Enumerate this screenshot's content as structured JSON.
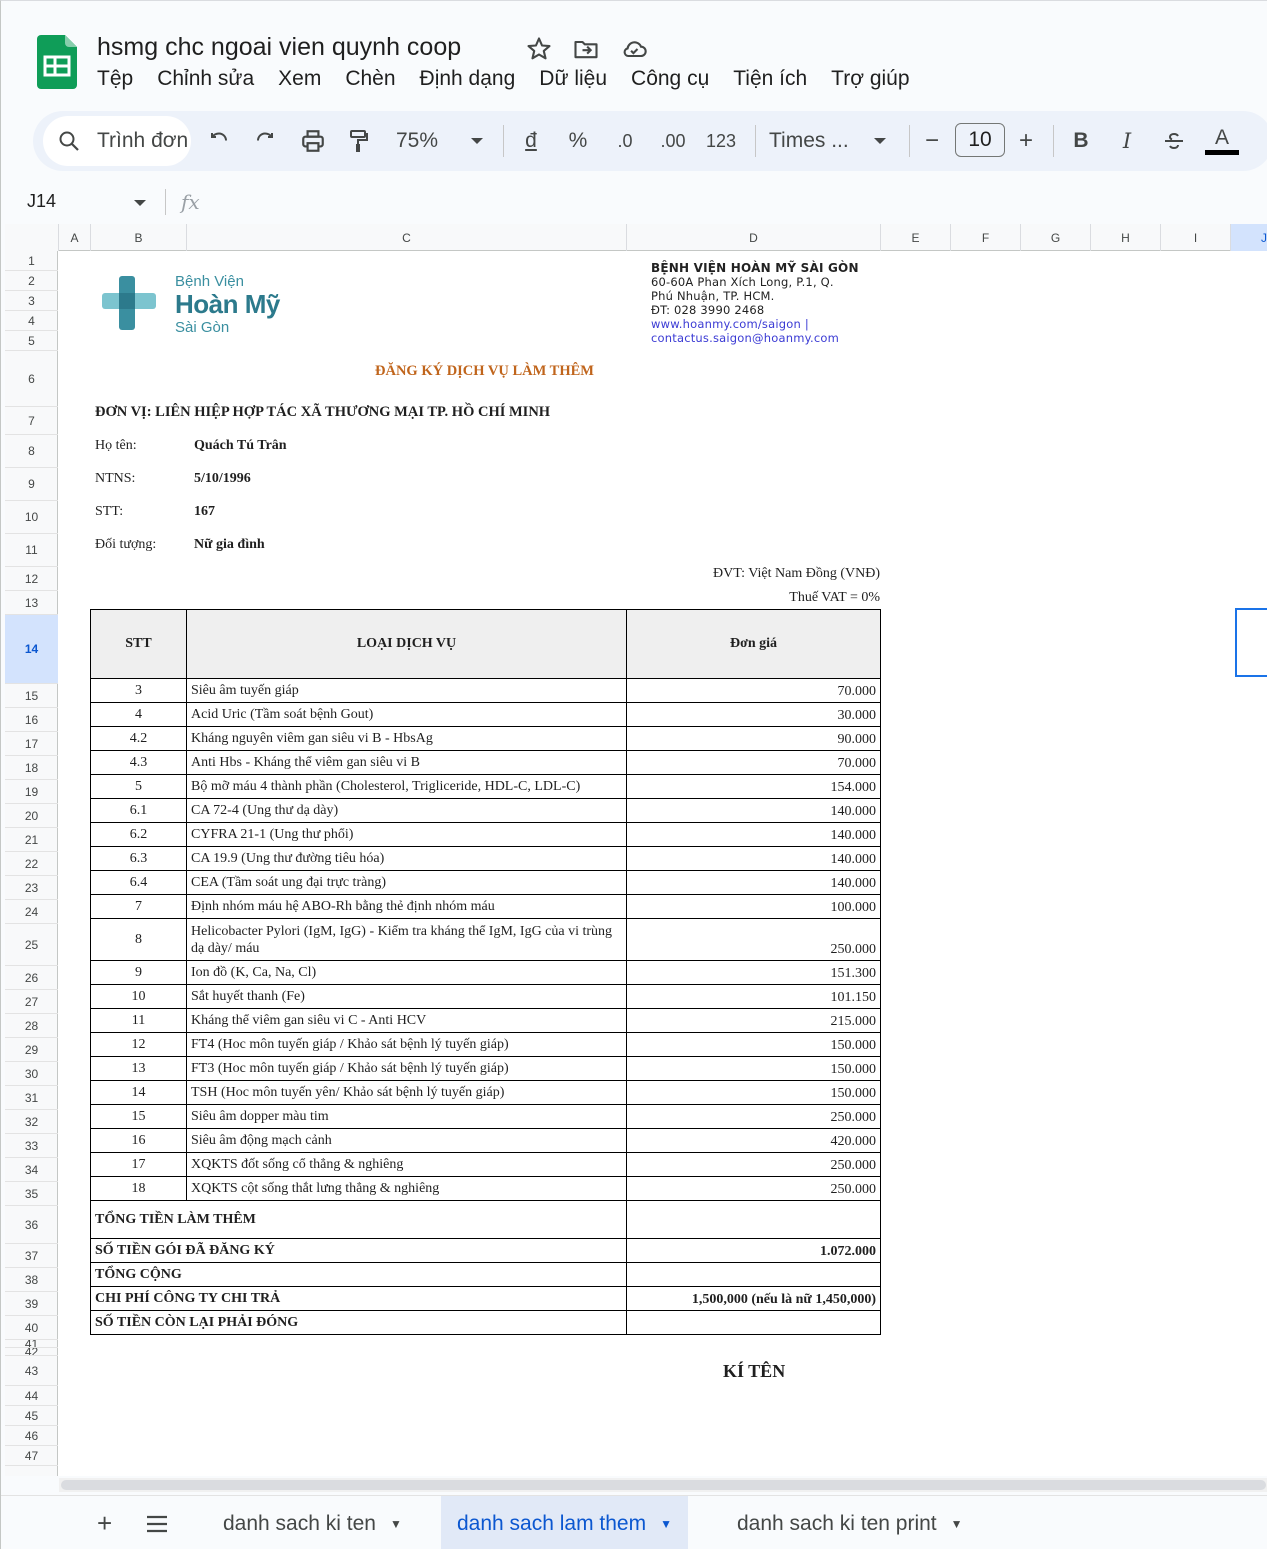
{
  "doc": {
    "title": "hsmg chc ngoai vien quynh coop"
  },
  "menu": [
    "Tệp",
    "Chỉnh sửa",
    "Xem",
    "Chèn",
    "Định dạng",
    "Dữ liệu",
    "Công cụ",
    "Tiện ích",
    "Trợ giúp"
  ],
  "toolbar": {
    "search_label": "Trình đơn",
    "zoom": "75%",
    "currency": "đ",
    "percent": "%",
    "dec_decrease": ".0",
    "dec_increase": ".00",
    "number_format": "123",
    "font": "Times ...",
    "font_size": "10",
    "minus": "−",
    "plus": "+",
    "bold": "B",
    "italic": "I",
    "text_color": "A"
  },
  "formula_bar": {
    "cell_ref": "J14",
    "fx": "fx",
    "formula": ""
  },
  "columns": [
    "A",
    "B",
    "C",
    "D",
    "E",
    "F",
    "G",
    "H",
    "I",
    "J"
  ],
  "rows": [
    "1",
    "2",
    "3",
    "4",
    "5",
    "6",
    "7",
    "8",
    "9",
    "10",
    "11",
    "12",
    "13",
    "14",
    "15",
    "16",
    "17",
    "18",
    "19",
    "20",
    "21",
    "22",
    "23",
    "24",
    "25",
    "26",
    "27",
    "28",
    "29",
    "30",
    "31",
    "32",
    "33",
    "34",
    "35",
    "36",
    "37",
    "38",
    "39",
    "40",
    "41",
    "42",
    "43",
    "44",
    "45",
    "46",
    "47"
  ],
  "logo": {
    "line1": "Bệnh Viện",
    "line2": "Hoàn Mỹ",
    "line3": "Sài Gòn"
  },
  "hospital": {
    "name": "BỆNH VIỆN HOÀN MỸ SÀI GÒN",
    "address1": "60-60A Phan Xích Long, P.1, Q.",
    "address2": "Phú Nhuận, TP. HCM.",
    "phone": "ĐT: 028 3990 2468",
    "web": "www.hoanmy.com/saigon |",
    "email": "contactus.saigon@hoanmy.com"
  },
  "form": {
    "heading": "ĐĂNG KÝ DỊCH VỤ LÀM THÊM",
    "unit": "ĐƠN VỊ: LIÊN HIỆP HỢP TÁC XÃ THƯƠNG MẠI TP. HỒ CHÍ MINH",
    "name_label": "Họ tên:",
    "name_value": "Quách Tú Trân",
    "dob_label": "NTNS:",
    "dob_value": "5/10/1996",
    "stt_label": "STT:",
    "stt_value": "167",
    "target_label": "Đối tượng:",
    "target_value": "Nữ gia đình",
    "currency_note": "ĐVT: Việt Nam Đồng (VNĐ)",
    "vat_note": "Thuế VAT = 0%",
    "sign": "KÍ TÊN"
  },
  "table": {
    "headers": [
      "STT",
      "LOẠI DỊCH VỤ",
      "Đơn giá"
    ],
    "rows": [
      {
        "stt": "3",
        "service": "Siêu âm tuyến giáp",
        "price": "70.000"
      },
      {
        "stt": "4",
        "service": "Acid Uric (Tầm soát bệnh Gout)",
        "price": "30.000"
      },
      {
        "stt": "4.2",
        "service": "Kháng nguyên viêm gan siêu vi B - HbsAg",
        "price": "90.000"
      },
      {
        "stt": "4.3",
        "service": "Anti Hbs - Kháng thể viêm gan siêu vi B",
        "price": "70.000"
      },
      {
        "stt": "5",
        "service": "Bộ mỡ máu 4 thành phần (Cholesterol, Trigliceride, HDL-C, LDL-C)",
        "price": "154.000"
      },
      {
        "stt": "6.1",
        "service": "CA 72-4 (Ung thư dạ dày)",
        "price": "140.000"
      },
      {
        "stt": "6.2",
        "service": "CYFRA 21-1 (Ung thư phổi)",
        "price": "140.000"
      },
      {
        "stt": "6.3",
        "service": "CA 19.9 (Ung thư đường tiêu hóa)",
        "price": "140.000"
      },
      {
        "stt": "6.4",
        "service": "CEA (Tầm soát ung đại trực tràng)",
        "price": "140.000"
      },
      {
        "stt": "7",
        "service": "Định nhóm máu hệ ABO-Rh bằng thẻ định nhóm máu",
        "price": "100.000"
      },
      {
        "stt": "8",
        "service": "Helicobacter Pylori (IgM, IgG) - Kiểm tra kháng thể IgM, IgG của vi trùng dạ dày/ máu",
        "price": "250.000"
      },
      {
        "stt": "9",
        "service": "Ion đồ (K, Ca, Na, Cl)",
        "price": "151.300"
      },
      {
        "stt": "10",
        "service": "Sắt huyết thanh (Fe)",
        "price": "101.150"
      },
      {
        "stt": "11",
        "service": "Kháng thể viêm gan siêu vi C - Anti HCV",
        "price": "215.000"
      },
      {
        "stt": "12",
        "service": "FT4 (Hoc môn tuyến giáp / Khảo sát bệnh lý tuyến giáp)",
        "price": "150.000"
      },
      {
        "stt": "13",
        "service": "FT3 (Hoc môn tuyến giáp / Khảo sát bệnh lý tuyến giáp)",
        "price": "150.000"
      },
      {
        "stt": "14",
        "service": "TSH (Hoc môn tuyến yên/ Khảo sát bệnh lý tuyến giáp)",
        "price": "150.000"
      },
      {
        "stt": "15",
        "service": "Siêu âm dopper màu tim",
        "price": "250.000"
      },
      {
        "stt": "16",
        "service": "Siêu âm động mạch cảnh",
        "price": "420.000"
      },
      {
        "stt": "17",
        "service": "XQKTS đốt sống cổ thẳng & nghiêng",
        "price": "250.000"
      },
      {
        "stt": "18",
        "service": "XQKTS cột sống thắt lưng thẳng & nghiêng",
        "price": "250.000"
      }
    ],
    "summary": [
      {
        "label": "TỔNG TIỀN LÀM THÊM",
        "value": ""
      },
      {
        "label": "SỐ TIỀN GÓI ĐÃ ĐĂNG KÝ",
        "value": "1.072.000"
      },
      {
        "label": "TỔNG CỘNG",
        "value": ""
      },
      {
        "label": "CHI PHÍ CÔNG TY CHI TRẢ",
        "value": "1,500,000 (nếu là nữ 1,450,000)"
      },
      {
        "label": "SỐ TIỀN CÒN LẠI PHẢI ĐÓNG",
        "value": ""
      }
    ]
  },
  "tabs": [
    {
      "label": "danh sach ki ten"
    },
    {
      "label": "danh sach lam them"
    },
    {
      "label": "danh sach ki ten print"
    }
  ],
  "colors": {
    "accent": "#0b57d0",
    "sheets_green": "#0f9d58",
    "logo_teal": "#3a8fa0",
    "heading_orange": "#c0651c"
  }
}
